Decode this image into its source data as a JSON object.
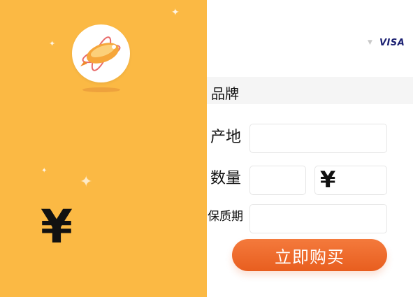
{
  "promo": {
    "logo_icon": "airship-logo-icon",
    "currency_symbol": "¥",
    "background_color": "#fbb944"
  },
  "payment": {
    "card_brand": "VISA",
    "chevron_icon": "chevron-down-icon"
  },
  "form": {
    "brand_label": "品牌",
    "origin_label": "产地",
    "origin_value": "",
    "quantity_label": "数量",
    "quantity_value": "",
    "price_currency": "¥",
    "price_value": "",
    "shelf_life_label": "保质期",
    "shelf_life_value": ""
  },
  "actions": {
    "buy_now_label": "立即购买",
    "accent_color": "#ee6a2a"
  }
}
